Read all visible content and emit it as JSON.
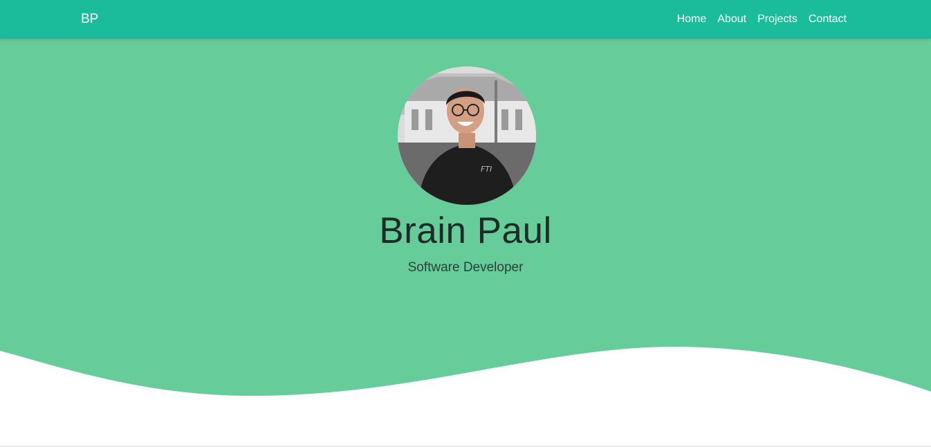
{
  "navbar": {
    "brand": "BP",
    "links": [
      "Home",
      "About",
      "Projects",
      "Contact"
    ]
  },
  "hero": {
    "name": "Brain Paul",
    "role": "Software Developer",
    "avatar_icon": "profile-photo"
  },
  "colors": {
    "navbar": "#1abc9c",
    "hero": "#66cc99",
    "text_dark": "#1e2b26",
    "background": "#ffffff"
  }
}
